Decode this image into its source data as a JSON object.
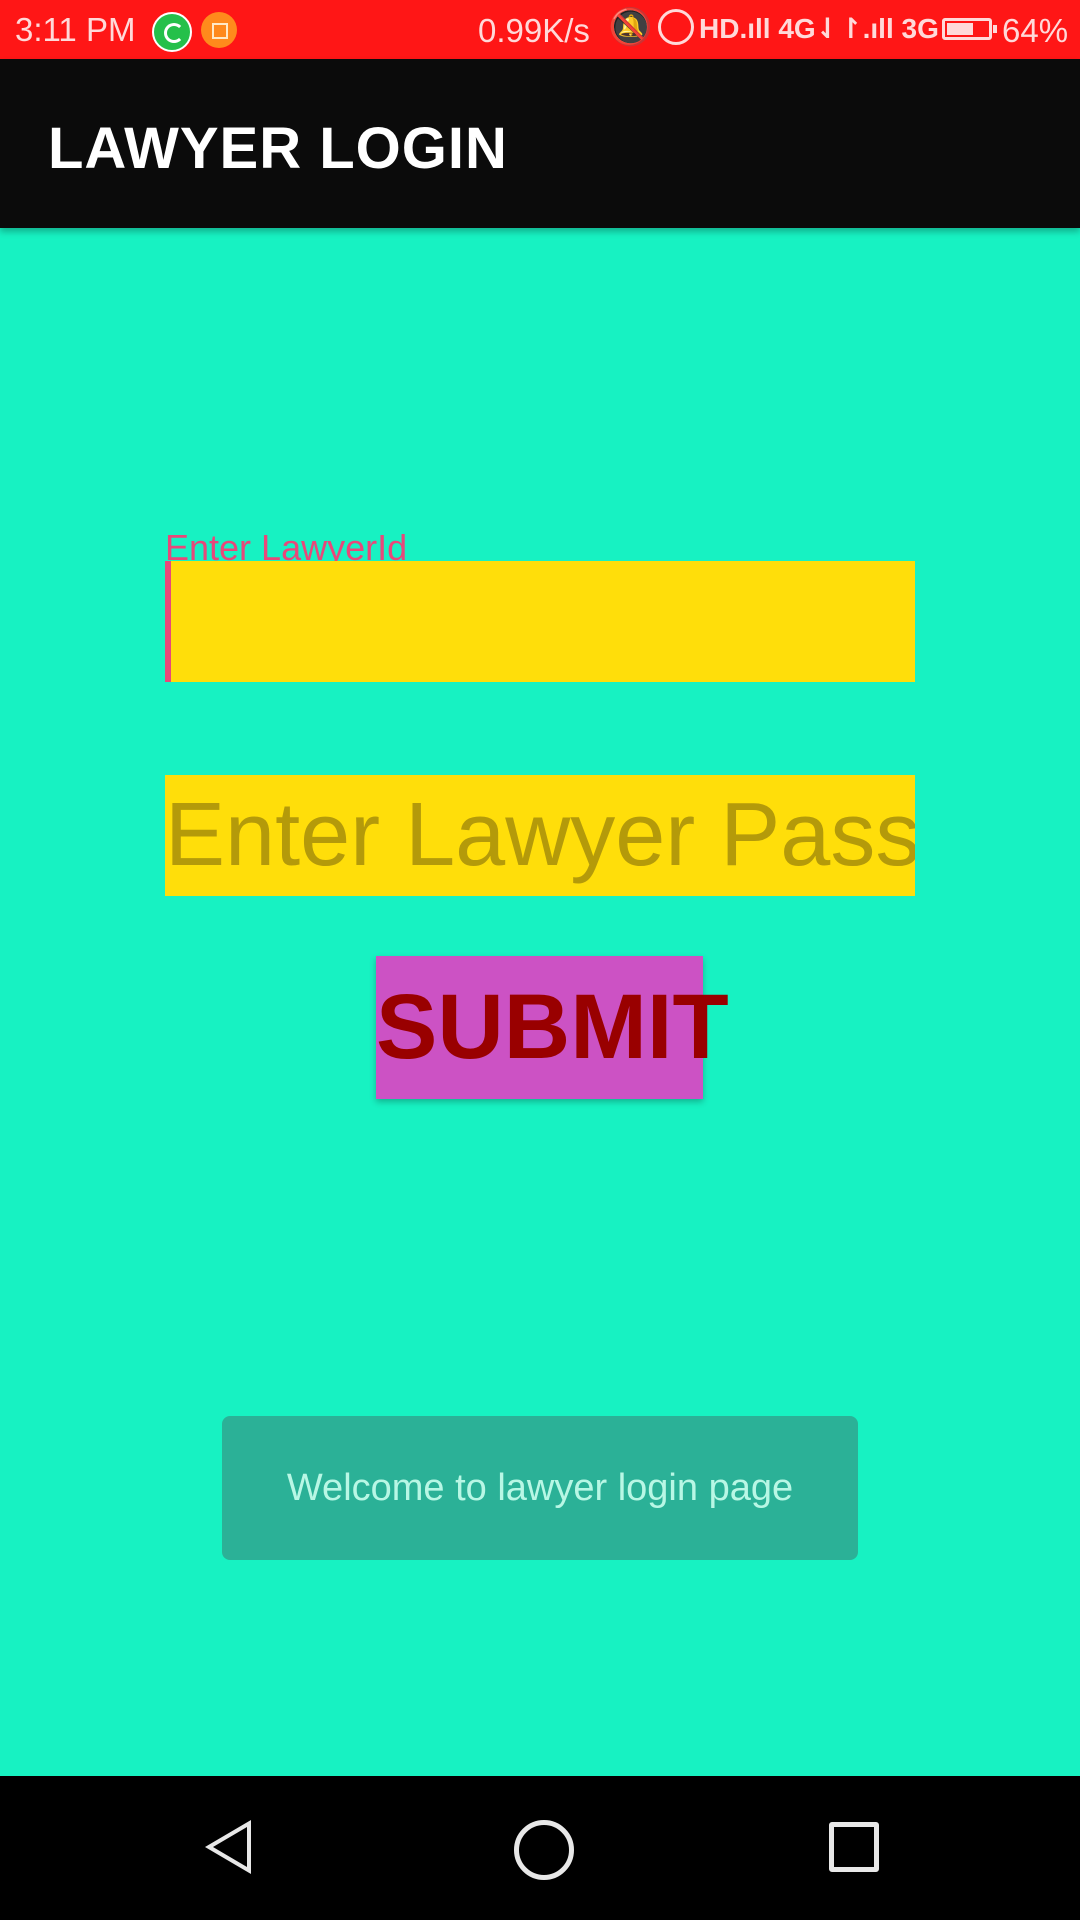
{
  "status_bar": {
    "time": "3:11 PM",
    "speed": "0.99K/s",
    "network": "HD.ıll 4G⇃↾.ıll 3G",
    "battery_percent": "64%",
    "battery_level": 0.64,
    "icons": [
      "whatsapp-icon",
      "app-notification-icon",
      "mute-icon",
      "alarm-icon",
      "signal-icon",
      "battery-icon"
    ]
  },
  "app_bar": {
    "title": "LAWYER LOGIN",
    "color": "#0b0b0b"
  },
  "form": {
    "lawyer_id_label": "Enter LawyerId",
    "lawyer_id_value": "",
    "password_placeholder": "Enter Lawyer Pass",
    "password_value": "",
    "submit_label": "SUBMIT"
  },
  "toast": {
    "message": "Welcome to lawyer login page"
  },
  "colors": {
    "background": "#17f2c2",
    "status_bar": "#ff1616",
    "field": "#ffde0a",
    "accent": "#e8487a",
    "button": "#cc52c4",
    "button_text": "#990000"
  },
  "nav_bar": {
    "icons": [
      "back-icon",
      "home-icon",
      "recents-icon"
    ]
  }
}
